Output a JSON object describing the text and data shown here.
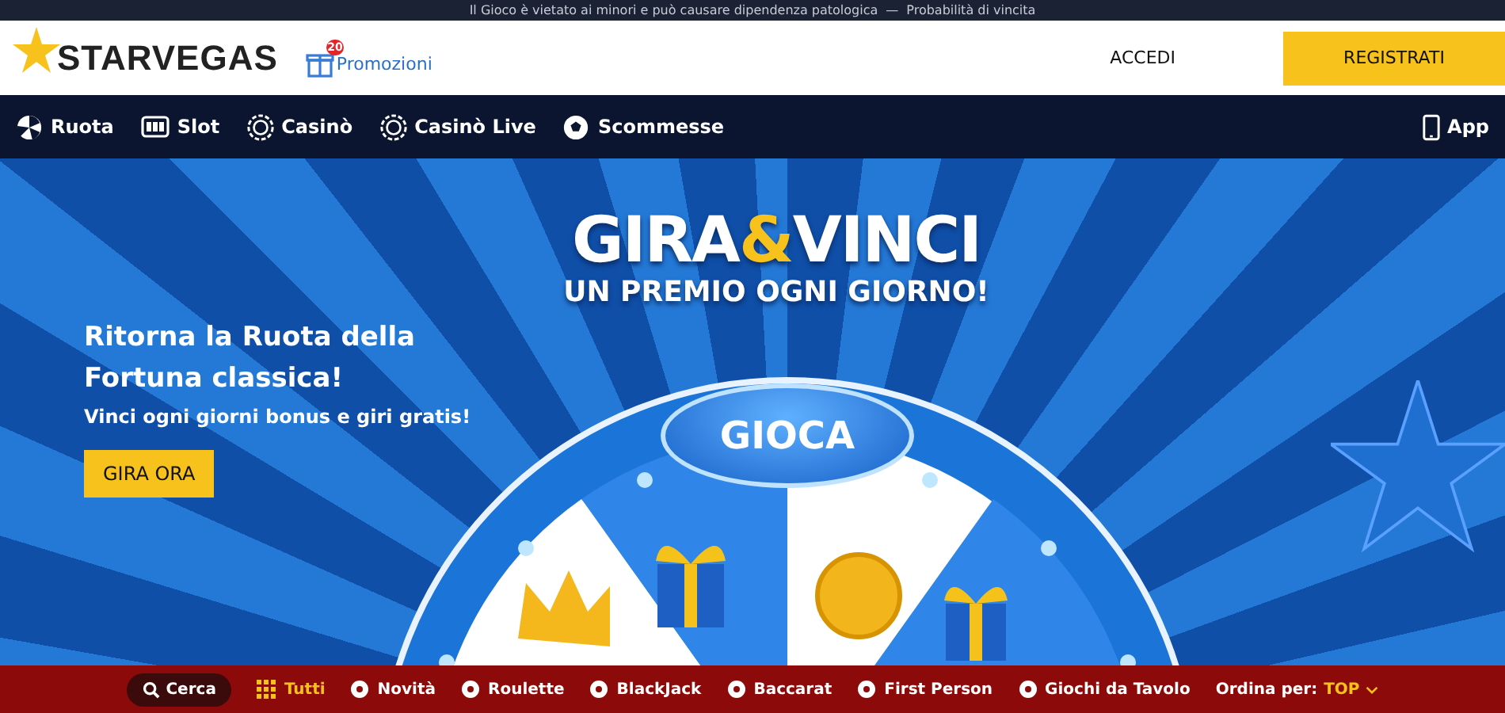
{
  "notice_bar": {
    "warning": "Il Gioco è vietato ai minori e può causare dipendenza patologica",
    "separator": "—",
    "link": "Probabilità di vincita"
  },
  "header": {
    "logo": "STARVEGAS",
    "promotions": {
      "label": "Promozioni",
      "badge": "20"
    },
    "login": "ACCEDI",
    "register": "REGISTRATI"
  },
  "nav": {
    "items": [
      {
        "label": "Ruota",
        "kind": "wheel"
      },
      {
        "label": "Slot",
        "kind": "slot"
      },
      {
        "label": "Casinò",
        "kind": "casino"
      },
      {
        "label": "Casinò Live",
        "kind": "casino"
      },
      {
        "label": "Scommesse",
        "kind": "sports"
      }
    ],
    "app": "App"
  },
  "hero": {
    "heading": "Ritorna la Ruota della Fortuna classica!",
    "subheading": "Vinci ogni giorni bonus e giri gratis!",
    "cta": "GIRA ORA",
    "banner": {
      "title_start": "GIRA",
      "ampersand": "&",
      "title_end": "VINCI",
      "tagline": "UN PREMIO OGNI GIORNO!",
      "wheel_button": "GIOCA"
    }
  },
  "filter_bar": {
    "search": "Cerca",
    "items": [
      {
        "label": "Tutti",
        "selected": true
      },
      {
        "label": "Novità",
        "selected": false
      },
      {
        "label": "Roulette",
        "selected": false
      },
      {
        "label": "BlackJack",
        "selected": false
      },
      {
        "label": "Baccarat",
        "selected": false
      },
      {
        "label": "First Person",
        "selected": false
      },
      {
        "label": "Giochi da Tavolo",
        "selected": false
      }
    ],
    "sort_label": "Ordina per:",
    "sort_value": "TOP"
  }
}
